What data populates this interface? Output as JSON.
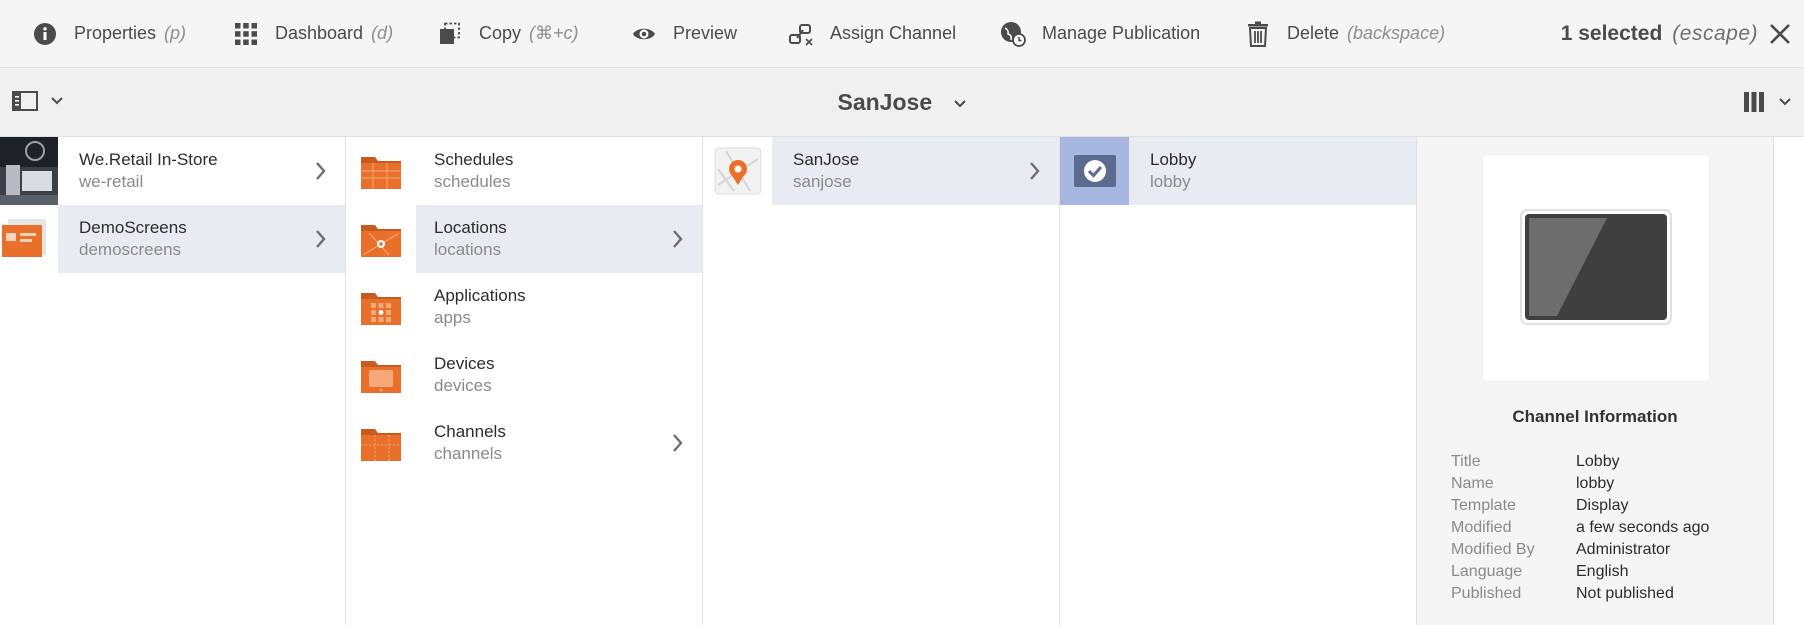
{
  "actionbar": {
    "actions": [
      {
        "label": "Properties",
        "key": "(p)",
        "icon": "info-icon"
      },
      {
        "label": "Dashboard",
        "key": "(d)",
        "icon": "grid-icon"
      },
      {
        "label": "Copy",
        "key": "(⌘+c)",
        "icon": "copy-icon"
      },
      {
        "label": "Preview",
        "key": "",
        "icon": "eye-icon"
      },
      {
        "label": "Assign Channel",
        "key": "",
        "icon": "link-icon"
      },
      {
        "label": "Manage Publication",
        "key": "",
        "icon": "globe-clock-icon"
      },
      {
        "label": "Delete",
        "key": "(backspace)",
        "icon": "trash-icon"
      }
    ],
    "selection_text": "1 selected",
    "selection_key": "(escape)"
  },
  "titlebar": {
    "title": "SanJose"
  },
  "columns": {
    "col1": [
      {
        "title": "We.Retail In-Store",
        "subtitle": "we-retail"
      },
      {
        "title": "DemoScreens",
        "subtitle": "demoscreens"
      }
    ],
    "col2": [
      {
        "title": "Schedules",
        "subtitle": "schedules"
      },
      {
        "title": "Locations",
        "subtitle": "locations"
      },
      {
        "title": "Applications",
        "subtitle": "apps"
      },
      {
        "title": "Devices",
        "subtitle": "devices"
      },
      {
        "title": "Channels",
        "subtitle": "channels"
      }
    ],
    "col3": [
      {
        "title": "SanJose",
        "subtitle": "sanjose"
      }
    ],
    "col4": [
      {
        "title": "Lobby",
        "subtitle": "lobby"
      }
    ]
  },
  "panel": {
    "heading": "Channel Information",
    "meta": [
      {
        "key": "Title",
        "value": "Lobby"
      },
      {
        "key": "Name",
        "value": "lobby"
      },
      {
        "key": "Template",
        "value": "Display"
      },
      {
        "key": "Modified",
        "value": "a few seconds ago"
      },
      {
        "key": "Modified By",
        "value": "Administrator"
      },
      {
        "key": "Language",
        "value": "English"
      },
      {
        "key": "Published",
        "value": "Not published"
      }
    ]
  },
  "colors": {
    "accent_orange": "#e8702a",
    "active_row": "#e8ebf2",
    "selected_thumb": "#a8b7e0"
  }
}
